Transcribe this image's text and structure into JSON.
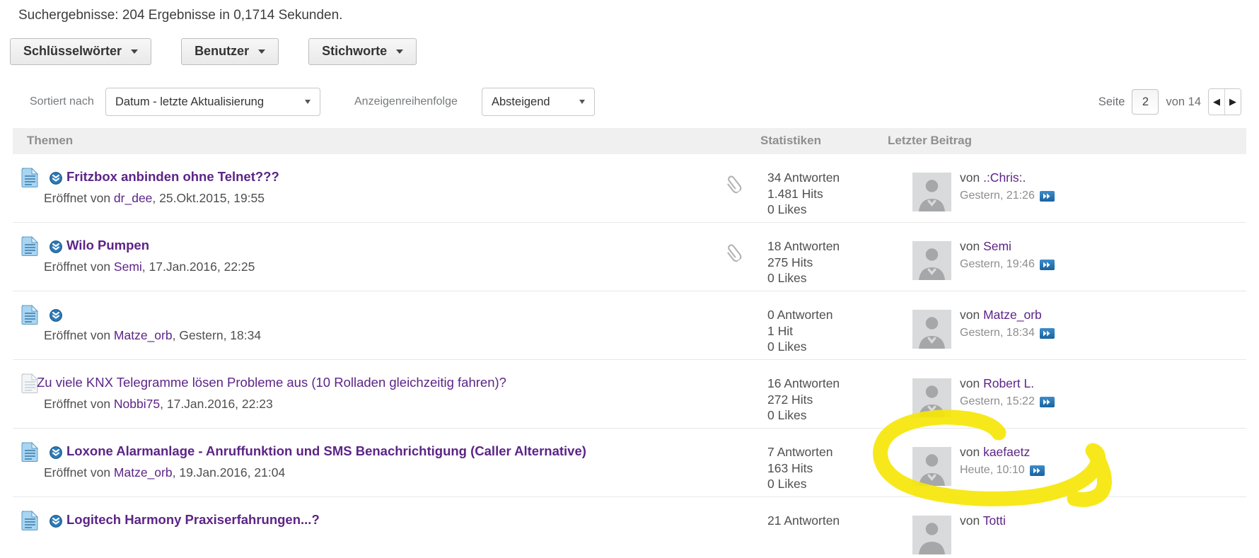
{
  "status_line": "Suchergebnisse: 204 Ergebnisse in 0,1714 Sekunden.",
  "filters": {
    "keywords": "Schlüsselwörter",
    "users": "Benutzer",
    "tags": "Stichworte"
  },
  "sort_bar": {
    "sort_label": "Sortiert nach",
    "sort_value": "Datum - letzte Aktualisierung",
    "order_label": "Anzeigenreihenfolge",
    "order_value": "Absteigend"
  },
  "pagination": {
    "page_label": "Seite",
    "current_page": "2",
    "total_label": "von 14",
    "prev_icon": "◀",
    "next_icon": "▶"
  },
  "table_headers": {
    "topics": "Themen",
    "stats": "Statistiken",
    "last_post": "Letzter Beitrag"
  },
  "threads": [
    {
      "title": "Fritzbox anbinden ohne Telnet???",
      "opened_prefix": "Eröffnet von ",
      "author": "dr_dee",
      "opened_suffix": ", 25.Okt.2015, 19:55",
      "replies": "34 Antworten",
      "hits": "1.481 Hits",
      "likes": "0 Likes",
      "last_prefix": "von ",
      "last_user": ".:Chris:.",
      "last_time": "Gestern, 21:26"
    },
    {
      "title": "Wilo Pumpen",
      "opened_prefix": "Eröffnet von ",
      "author": "Semi",
      "opened_suffix": ", 17.Jan.2016, 22:25",
      "replies": "18 Antworten",
      "hits": "275 Hits",
      "likes": "0 Likes",
      "last_prefix": "von ",
      "last_user": "Semi",
      "last_time": "Gestern, 19:46"
    },
    {
      "title": "",
      "opened_prefix": "Eröffnet von ",
      "author": "Matze_orb",
      "opened_suffix": ", Gestern, 18:34",
      "replies": "0 Antworten",
      "hits": "1 Hit",
      "likes": "0 Likes",
      "last_prefix": "von ",
      "last_user": "Matze_orb",
      "last_time": "Gestern, 18:34"
    },
    {
      "title": "Zu viele KNX Telegramme lösen Probleme aus (10 Rolladen gleichzeitig fahren)?",
      "opened_prefix": "Eröffnet von ",
      "author": "Nobbi75",
      "opened_suffix": ", 17.Jan.2016, 22:23",
      "replies": "16 Antworten",
      "hits": "272 Hits",
      "likes": "0 Likes",
      "last_prefix": "von ",
      "last_user": "Robert L.",
      "last_time": "Gestern, 15:22"
    },
    {
      "title": "Loxone Alarmanlage - Anruffunktion und SMS Benachrichtigung (Caller Alternative)",
      "opened_prefix": "Eröffnet von ",
      "author": "Matze_orb",
      "opened_suffix": ", 19.Jan.2016, 21:04",
      "replies": "7 Antworten",
      "hits": "163 Hits",
      "likes": "0 Likes",
      "last_prefix": "von ",
      "last_user": "kaefaetz",
      "last_time": "Heute, 10:10"
    },
    {
      "title": "Logitech Harmony Praxiserfahrungen...?",
      "replies": "21 Antworten",
      "last_prefix": "von ",
      "last_user": "Totti"
    }
  ],
  "icons": {
    "thread_document": "document-icon",
    "go_to_unread": "circle-arrow-down-icon",
    "attachment": "paperclip-icon",
    "go_to_last_post": "double-arrow-right-icon",
    "avatar": "default-avatar-silhouette"
  },
  "annotation": {
    "type": "yellow-highlighter-circle",
    "circled_text": "von kaefaetz, Heute, 10:10"
  },
  "colors": {
    "link_purple": "#5c2487",
    "badge_blue": "#2173b4",
    "header_bg": "#f0f0f0",
    "highlight_yellow": "#f6e609"
  }
}
